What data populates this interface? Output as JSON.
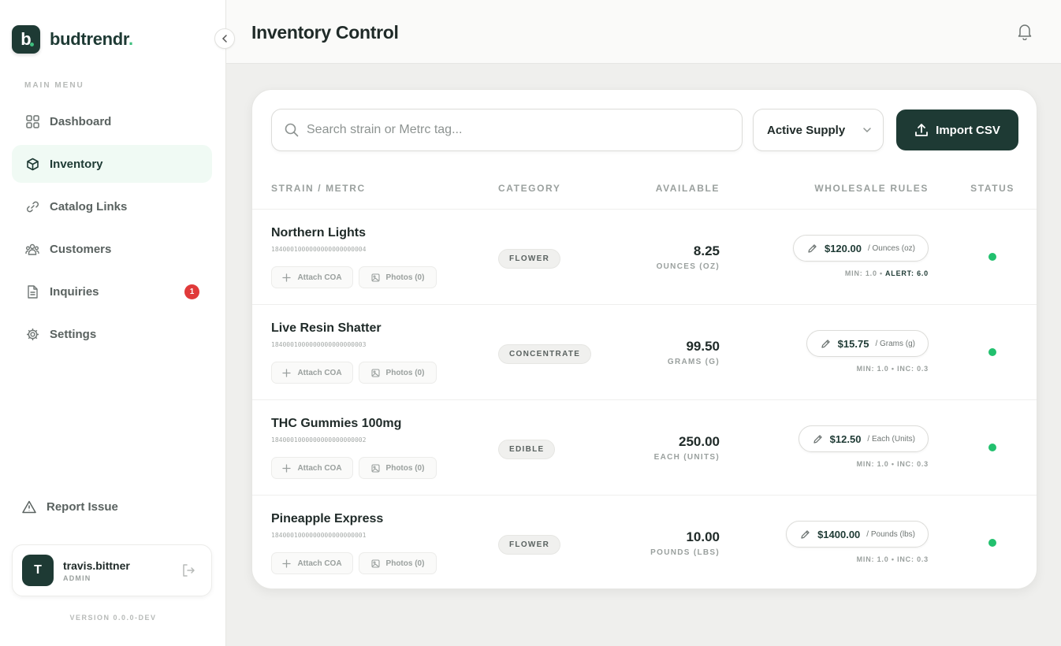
{
  "brand": {
    "mark": "b",
    "name_main": "budtrendr",
    "name_accent": "."
  },
  "sidebar": {
    "menu_label": "MAIN MENU",
    "items": [
      {
        "label": "Dashboard",
        "icon": "grid-icon",
        "active": false
      },
      {
        "label": "Inventory",
        "icon": "box-icon",
        "active": true
      },
      {
        "label": "Catalog Links",
        "icon": "link-icon",
        "active": false
      },
      {
        "label": "Customers",
        "icon": "users-icon",
        "active": false
      },
      {
        "label": "Inquiries",
        "icon": "document-icon",
        "active": false,
        "badge": "1"
      },
      {
        "label": "Settings",
        "icon": "gear-icon",
        "active": false
      }
    ],
    "report_label": "Report Issue",
    "user": {
      "initial": "T",
      "name": "travis.bittner",
      "role": "ADMIN"
    },
    "version": "VERSION 0.0.0-DEV"
  },
  "header": {
    "title": "Inventory Control"
  },
  "toolbar": {
    "search_placeholder": "Search strain or Metrc tag...",
    "filter_value": "Active Supply",
    "import_label": "Import CSV"
  },
  "table": {
    "columns": [
      "STRAIN / METRC",
      "CATEGORY",
      "AVAILABLE",
      "WHOLESALE RULES",
      "STATUS"
    ],
    "attach_label": "Attach COA",
    "photos_label": "Photos (0)",
    "rows": [
      {
        "name": "Northern Lights",
        "metrc": "1840001000000000000000004",
        "category": "FLOWER",
        "qty": "8.25",
        "unit": "OUNCES (OZ)",
        "price": "$120.00",
        "price_unit": "/ Ounces (oz)",
        "rule_a": "MIN: 1.0 •",
        "rule_b": "ALERT: 6.0",
        "status_color": "#22c06e"
      },
      {
        "name": "Live Resin Shatter",
        "metrc": "1840001000000000000000003",
        "category": "CONCENTRATE",
        "qty": "99.50",
        "unit": "GRAMS (G)",
        "price": "$15.75",
        "price_unit": "/ Grams (g)",
        "rule_a": "MIN: 1.0 • INC: 0.3",
        "rule_b": "",
        "status_color": "#22c06e"
      },
      {
        "name": "THC Gummies 100mg",
        "metrc": "1840001000000000000000002",
        "category": "EDIBLE",
        "qty": "250.00",
        "unit": "EACH (UNITS)",
        "price": "$12.50",
        "price_unit": "/ Each (Units)",
        "rule_a": "MIN: 1.0 • INC: 0.3",
        "rule_b": "",
        "status_color": "#22c06e"
      },
      {
        "name": "Pineapple Express",
        "metrc": "1840001000000000000000001",
        "category": "FLOWER",
        "qty": "10.00",
        "unit": "POUNDS (LBS)",
        "price": "$1400.00",
        "price_unit": "/ Pounds (lbs)",
        "rule_a": "MIN: 1.0 • INC: 0.3",
        "rule_b": "",
        "status_color": "#22c06e"
      }
    ]
  }
}
